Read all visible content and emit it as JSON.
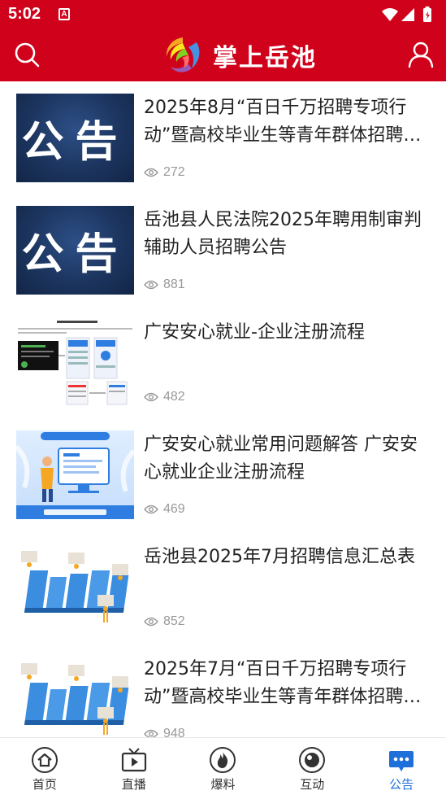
{
  "status_bar": {
    "time": "5:02",
    "badge": "A"
  },
  "header": {
    "title": "掌上岳池",
    "accent": "#d0021b"
  },
  "articles": [
    {
      "title": "2025年8月“百日千万招聘专项行动”暨高校毕业生等青年群体招聘…",
      "views": "272",
      "thumb_text": "公告"
    },
    {
      "title": "岳池县人民法院2025年聘用制审判辅助人员招聘公告",
      "views": "881",
      "thumb_text": "公告"
    },
    {
      "title": "广安安心就业-企业注册流程",
      "views": "482"
    },
    {
      "title": "广安安心就业常用问题解答 广安安心就业企业注册流程",
      "views": "469"
    },
    {
      "title": "岳池县2025年7月招聘信息汇总表",
      "views": "852"
    },
    {
      "title": "2025年7月“百日千万招聘专项行动”暨高校毕业生等青年群体招聘…",
      "views": "948"
    }
  ],
  "tabs": [
    {
      "label": "首页"
    },
    {
      "label": "直播"
    },
    {
      "label": "爆料"
    },
    {
      "label": "互动"
    },
    {
      "label": "公告"
    }
  ],
  "active_tab_color": "#1e6fd9"
}
